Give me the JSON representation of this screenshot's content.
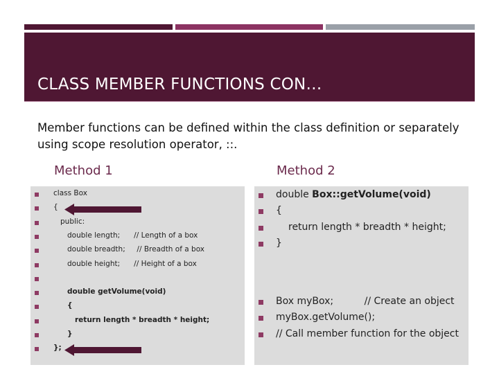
{
  "colors": {
    "header_bg": "#4f1733",
    "accent_bar_1": "#4f1733",
    "accent_bar_2": "#8c3362",
    "accent_bar_3": "#9aa0a8",
    "method_heading": "#6b2a4c",
    "bullet": "#8e3a63",
    "panel_bg": "#dcdcdc"
  },
  "slide": {
    "title": "CLASS MEMBER FUNCTIONS CON…",
    "intro": "Member functions can be defined within the class definition or separately using scope resolution operator, ::.",
    "method1": {
      "heading": "Method 1",
      "lines": [
        {
          "text": "class Box",
          "indent": 0,
          "bold": false
        },
        {
          "text": "{",
          "indent": 0,
          "bold": false
        },
        {
          "text": "public:",
          "indent": 1,
          "bold": false
        },
        {
          "text": "double length;      // Length of a box",
          "indent": 2,
          "bold": false
        },
        {
          "text": "double breadth;     // Breadth of a box",
          "indent": 2,
          "bold": false
        },
        {
          "text": "double height;      // Height of a box",
          "indent": 2,
          "bold": false
        },
        {
          "text": "",
          "indent": 2,
          "bold": false
        },
        {
          "text": "double getVolume(void)",
          "indent": 2,
          "bold": true
        },
        {
          "text": "{",
          "indent": 2,
          "bold": true
        },
        {
          "text": "return length * breadth * height;",
          "indent": 3,
          "bold": true
        },
        {
          "text": "}",
          "indent": 2,
          "bold": true
        },
        {
          "text": "};",
          "indent": 0,
          "bold": true
        }
      ],
      "arrows": [
        {
          "points_to_line": 1,
          "icon": "left-arrow-icon"
        },
        {
          "points_to_line": 11,
          "icon": "left-arrow-icon"
        }
      ]
    },
    "method2": {
      "heading": "Method 2",
      "lines": [
        {
          "parts": [
            {
              "text": "double ",
              "bold": false
            },
            {
              "text": "Box::getVolume(void)",
              "bold": true
            }
          ],
          "indent": 0
        },
        {
          "parts": [
            {
              "text": "{",
              "bold": false
            }
          ],
          "indent": 0
        },
        {
          "parts": [
            {
              "text": "return length * breadth * height;",
              "bold": false
            }
          ],
          "indent": 1
        },
        {
          "parts": [
            {
              "text": "}",
              "bold": false
            }
          ],
          "indent": 0
        },
        {
          "parts": [
            {
              "text": "Box myBox;          // Create an object",
              "bold": false
            }
          ],
          "indent": 0
        },
        {
          "parts": [
            {
              "text": "myBox.getVolume();",
              "bold": false
            }
          ],
          "indent": 0
        },
        {
          "parts": [
            {
              "text": "// Call member function for the object",
              "bold": false
            }
          ],
          "indent": 0
        }
      ]
    }
  }
}
